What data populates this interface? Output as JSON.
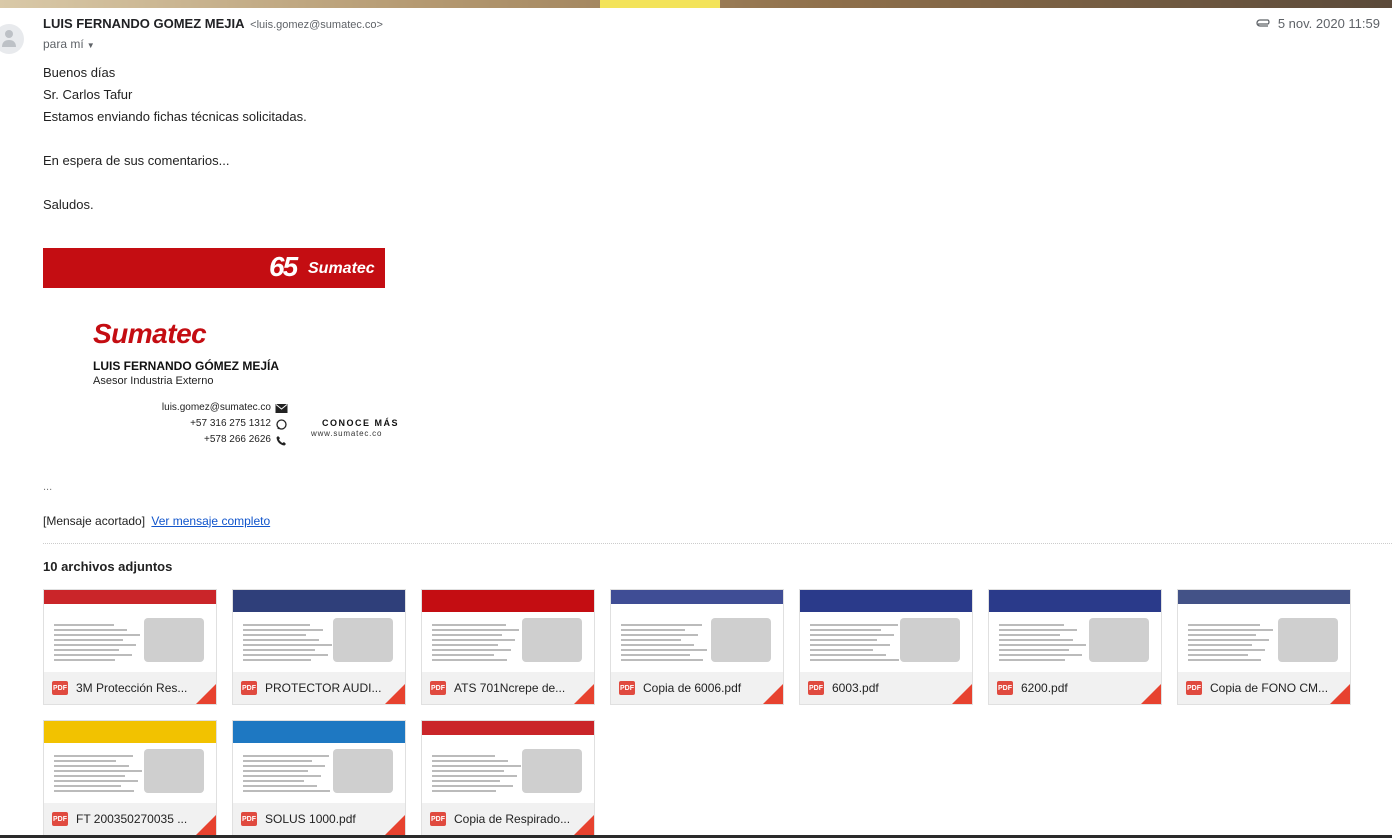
{
  "sender": {
    "name": "LUIS FERNANDO GOMEZ MEJIA",
    "email": "<luis.gomez@sumatec.co>",
    "to_label": "para mí",
    "date": "5 nov. 2020 11:59"
  },
  "message": {
    "lines": [
      "Buenos días",
      "Sr. Carlos Tafur",
      "Estamos enviando fichas técnicas solicitadas.",
      "",
      "En espera de sus comentarios...",
      "",
      "Saludos."
    ]
  },
  "signature": {
    "banner_number": "65",
    "banner_brand": "Sumatec",
    "logo": "Sumatec",
    "name": "LUIS FERNANDO GÓMEZ MEJÍA",
    "role": "Asesor Industria Externo",
    "email": "luis.gomez@sumatec.co",
    "phone_mobile": "+57 316 275 1312",
    "phone_office": "+578 266 2626",
    "cta": "CONOCE MÁS",
    "cta_url": "www.sumatec.co"
  },
  "truncated": {
    "ellipsis": "...",
    "label": "[Mensaje acortado]",
    "link": "Ver mensaje completo"
  },
  "attachments": {
    "title": "10 archivos adjuntos",
    "badge": "PDF",
    "items": [
      {
        "name": "3M Protección Res...",
        "accent": "#c40d12"
      },
      {
        "name": "PROTECTOR AUDI...",
        "accent": "#2f3f7a"
      },
      {
        "name": "ATS 701Ncrepe de...",
        "accent": "#c40d12"
      },
      {
        "name": "Copia de 6006.pdf",
        "accent": "#2a3a8a"
      },
      {
        "name": "6003.pdf",
        "accent": "#2a3a8a"
      },
      {
        "name": "6200.pdf",
        "accent": "#2a3a8a"
      },
      {
        "name": "Copia de FONO CM...",
        "accent": "#2f3f7a"
      },
      {
        "name": "FT 200350270035 ...",
        "accent": "#f2c200"
      },
      {
        "name": "SOLUS 1000.pdf",
        "accent": "#1e78c2"
      },
      {
        "name": "Copia de Respirado...",
        "accent": "#c40d12"
      }
    ]
  }
}
